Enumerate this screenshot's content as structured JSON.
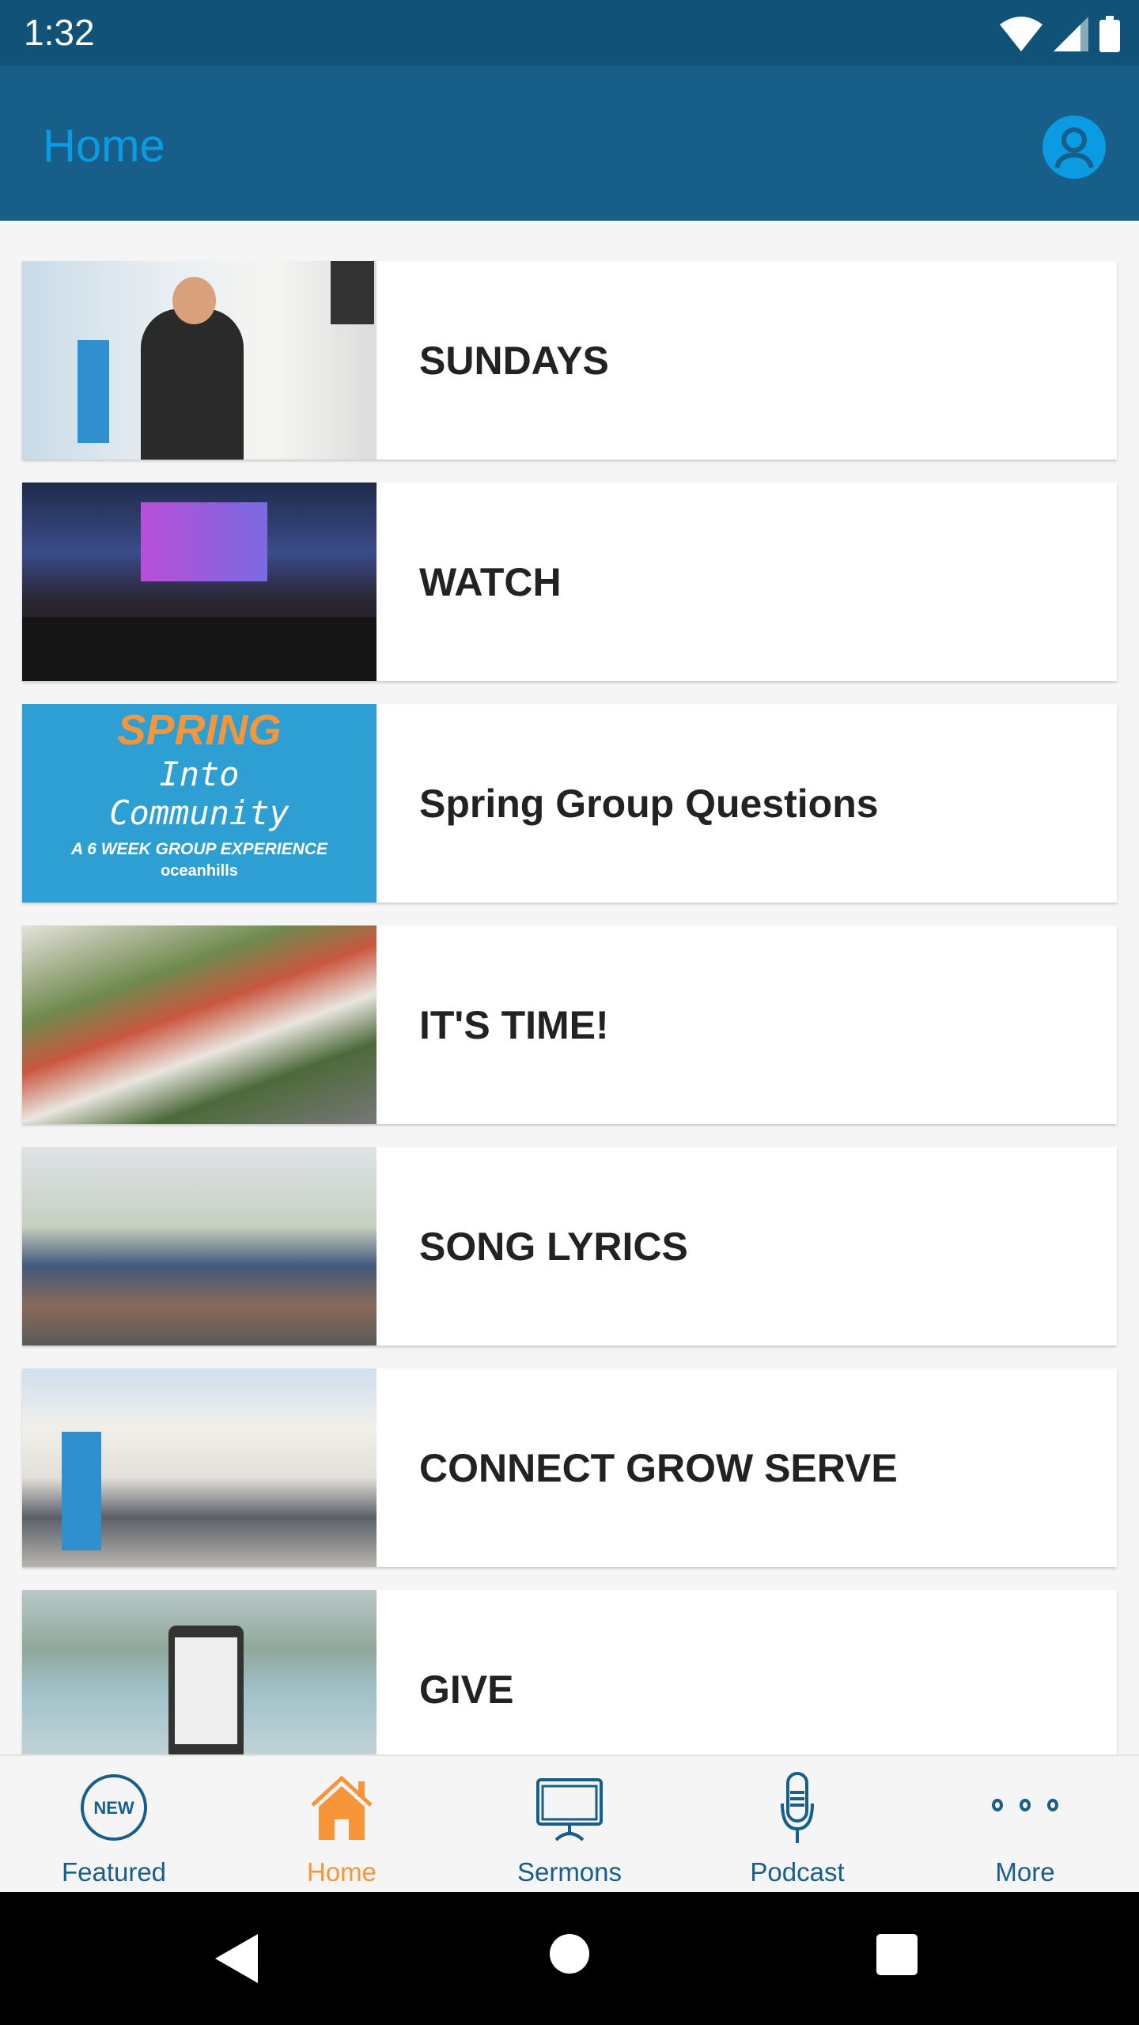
{
  "status_bar": {
    "time": "1:32",
    "icons": [
      "wifi-icon",
      "signal-icon",
      "battery-icon"
    ]
  },
  "app_bar": {
    "title": "Home",
    "profile_icon": "account-circle-icon"
  },
  "colors": {
    "status_bar": "#105278",
    "app_bar": "#175e89",
    "title": "#0a9be3",
    "active_tab": "#f7953a",
    "inactive_tab": "#175e89"
  },
  "items": [
    {
      "label": "SUNDAYS"
    },
    {
      "label": "WATCH"
    },
    {
      "label": "Spring Group Questions",
      "image_text": {
        "line1": "SPRING",
        "line2": "Into",
        "line3": "Community",
        "line4": "A 6 WEEK GROUP EXPERIENCE",
        "logo": "oceanhills"
      }
    },
    {
      "label": "IT'S TIME!"
    },
    {
      "label": "SONG LYRICS"
    },
    {
      "label": "CONNECT GROW SERVE"
    },
    {
      "label": "GIVE"
    }
  ],
  "bottom_nav": [
    {
      "label": "Featured",
      "icon": "new-badge-icon",
      "badge": "NEW"
    },
    {
      "label": "Home",
      "icon": "home-icon",
      "active": true
    },
    {
      "label": "Sermons",
      "icon": "monitor-icon"
    },
    {
      "label": "Podcast",
      "icon": "microphone-icon"
    },
    {
      "label": "More",
      "icon": "more-dots-icon"
    }
  ],
  "system_nav": [
    "back-icon",
    "home-circle-icon",
    "recents-icon"
  ]
}
